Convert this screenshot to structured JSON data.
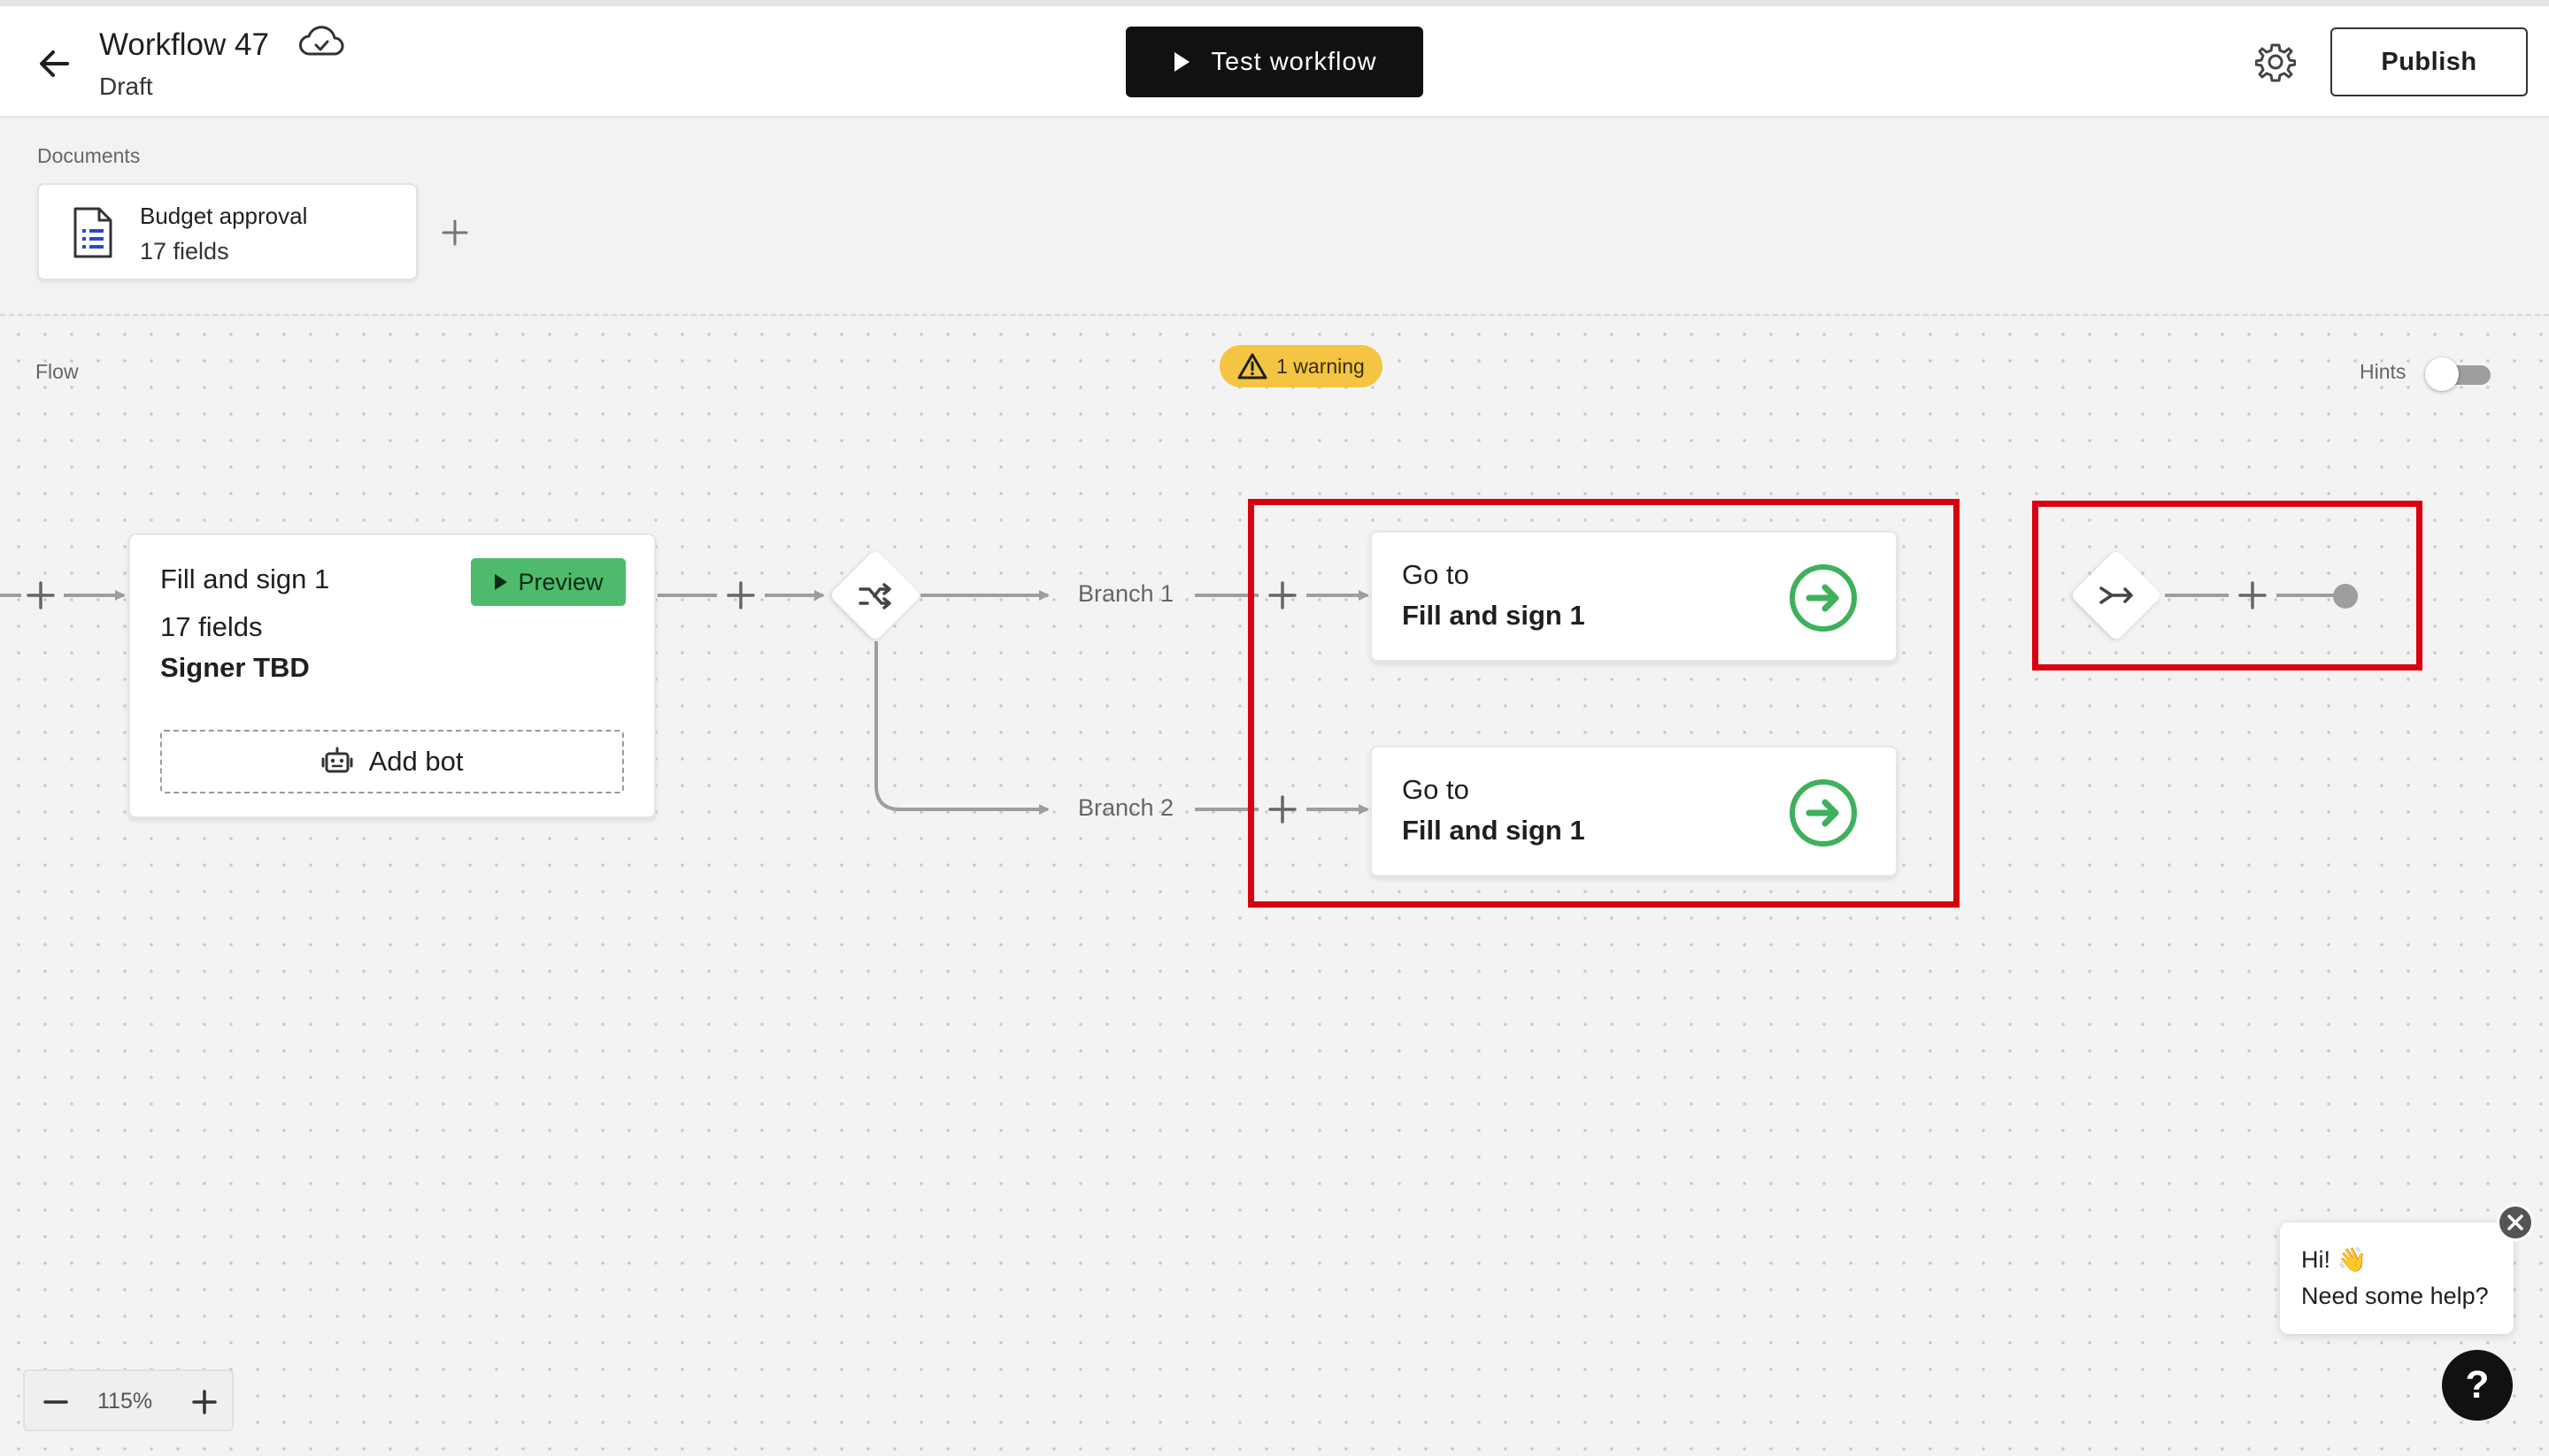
{
  "header": {
    "title": "Workflow 47",
    "status": "Draft",
    "test_button_label": "Test workflow",
    "publish_button_label": "Publish"
  },
  "documents": {
    "section_label": "Documents",
    "items": [
      {
        "title": "Budget approval",
        "subtitle": "17 fields"
      }
    ]
  },
  "flow": {
    "section_label": "Flow",
    "warning_text": "1 warning",
    "hints_label": "Hints",
    "hints_enabled": false,
    "fill_step": {
      "title": "Fill and sign 1",
      "fields": "17 fields",
      "signer": "Signer TBD",
      "preview_label": "Preview",
      "add_bot_label": "Add bot"
    },
    "branches": [
      {
        "label": "Branch 1",
        "goto_prefix": "Go to",
        "goto_target": "Fill and sign 1"
      },
      {
        "label": "Branch 2",
        "goto_prefix": "Go to",
        "goto_target": "Fill and sign 1"
      }
    ]
  },
  "zoom": {
    "level": "115%"
  },
  "chat": {
    "greeting": "Hi! 👋",
    "message": "Need some help?",
    "help_glyph": "?"
  },
  "colors": {
    "accent_green": "#4dbb6b",
    "warning_yellow": "#f4c542",
    "highlight_red": "#d9000f",
    "button_dark": "#111111"
  },
  "icons": {
    "back": "arrow-left-icon",
    "cloud": "cloud-check-icon",
    "play": "play-icon",
    "settings": "gear-icon",
    "document": "document-icon",
    "warning": "warning-triangle-icon",
    "robot": "robot-icon",
    "split": "split-branch-icon",
    "merge": "merge-icon",
    "goto": "arrow-circle-right-icon",
    "help": "question-icon",
    "close": "close-icon"
  }
}
